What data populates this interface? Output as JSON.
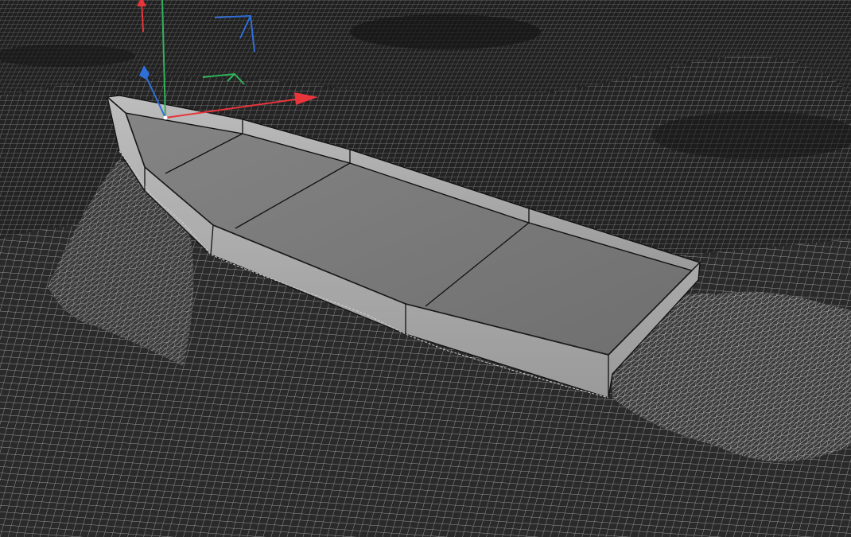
{
  "viewport": {
    "name": "3d-viewport",
    "scene": "boat-hull-on-wireframe-terrain"
  },
  "colors": {
    "background": "#1c1c1c",
    "wire_light": "#9a9a9a",
    "wire_dark": "#3a3a3a",
    "hull_floor": "#7b7b7b",
    "hull_wall": "#a9a9a9",
    "hull_rim": "#b8b8b8",
    "hull_edge": "#111111",
    "axis_x": "#e8343b",
    "axis_y": "#2fb35a",
    "axis_z": "#2f6fd8"
  },
  "gizmo": {
    "icons": [
      "move-x-arrow-icon",
      "move-y-arrow-icon",
      "move-z-arrow-icon",
      "plane-xy-handle-icon",
      "plane-xz-handle-icon",
      "origin-pivot-icon"
    ]
  }
}
